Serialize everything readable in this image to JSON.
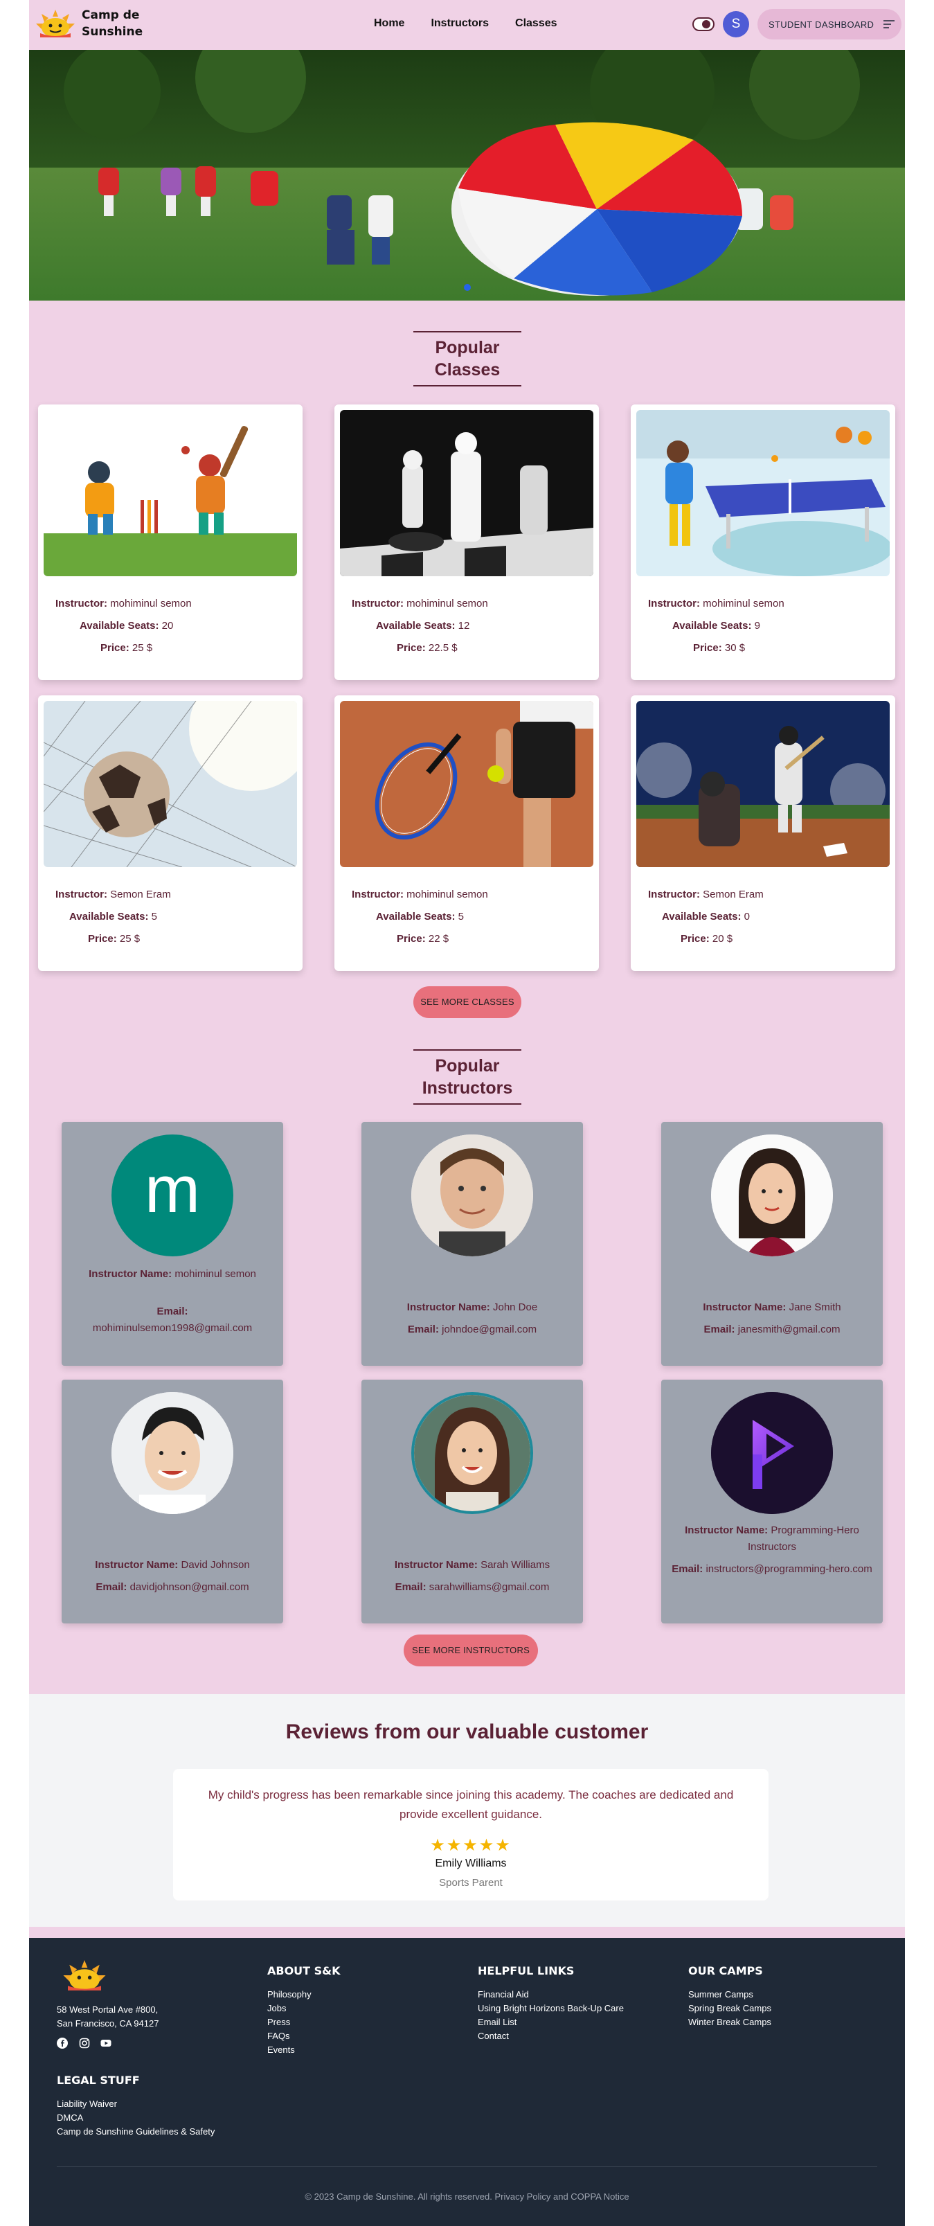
{
  "nav": {
    "brand": "Camp de Sunshine",
    "links": [
      "Home",
      "Instructors",
      "Classes"
    ],
    "avatar_letter": "S",
    "dashboard_label": "STUDENT DASHBOARD"
  },
  "popular_classes": {
    "title": "Popular Classes",
    "labels": {
      "instructor": "Instructor:",
      "seats": "Available Seats:",
      "price": "Price:"
    },
    "items": [
      {
        "icon": "cricket-image",
        "instructor": "mohiminul semon",
        "seats": "20",
        "price": "25 $"
      },
      {
        "icon": "chess-image",
        "instructor": "mohiminul semon",
        "seats": "12",
        "price": "22.5 $"
      },
      {
        "icon": "table-tennis-image",
        "instructor": "mohiminul semon",
        "seats": "9",
        "price": "30 $"
      },
      {
        "icon": "football-image",
        "instructor": "Semon Eram",
        "seats": "5",
        "price": "25 $"
      },
      {
        "icon": "tennis-image",
        "instructor": "mohiminul semon",
        "seats": "5",
        "price": "22 $"
      },
      {
        "icon": "baseball-image",
        "instructor": "Semon Eram",
        "seats": "0",
        "price": "20 $"
      }
    ],
    "see_more": "SEE MORE CLASSES"
  },
  "popular_instructors": {
    "title": "Popular Instructors",
    "labels": {
      "name": "Instructor Name:",
      "email": "Email:"
    },
    "items": [
      {
        "name": "mohiminul semon",
        "email": "mohiminulsemon1998@gmail.com",
        "avatar_letter": "m"
      },
      {
        "name": "John Doe",
        "email": "johndoe@gmail.com"
      },
      {
        "name": "Jane Smith",
        "email": "janesmith@gmail.com"
      },
      {
        "name": "David Johnson",
        "email": "davidjohnson@gmail.com"
      },
      {
        "name": "Sarah Williams",
        "email": "sarahwilliams@gmail.com"
      },
      {
        "name": "Programming-Hero Instructors",
        "email": "instructors@programming-hero.com"
      }
    ],
    "see_more": "SEE MORE INSTRUCTORS"
  },
  "reviews": {
    "title": "Reviews from our valuable customer",
    "text": "My child's progress has been remarkable since joining this academy. The coaches are dedicated and provide excellent guidance.",
    "rating": 5,
    "stars": "★★★★★",
    "name": "Emily Williams",
    "role": "Sports Parent"
  },
  "footer": {
    "address_line1": "58 West Portal Ave #800,",
    "address_line2": "San Francisco, CA 94127",
    "about_title": "ABOUT S&K",
    "about_links": [
      "Philosophy",
      "Jobs",
      "Press",
      "FAQs",
      "Events"
    ],
    "helpful_title": "HELPFUL LINKS",
    "helpful_links": [
      "Financial Aid",
      "Using Bright Horizons Back-Up Care",
      "Email List",
      "Contact"
    ],
    "camps_title": "OUR CAMPS",
    "camps_links": [
      "Summer Camps",
      "Spring Break Camps",
      "Winter Break Camps"
    ],
    "legal_title": "LEGAL STUFF",
    "legal_links": [
      "Liability Waiver",
      "DMCA",
      "Camp de Sunshine Guidelines & Safety"
    ],
    "copyright": "© 2023 Camp de Sunshine. All rights reserved. Privacy Policy and COPPA Notice"
  },
  "colors": {
    "accent": "#5b2235",
    "background": "#f0d2e6",
    "button": "#e8707c",
    "footer": "#1f2937"
  }
}
